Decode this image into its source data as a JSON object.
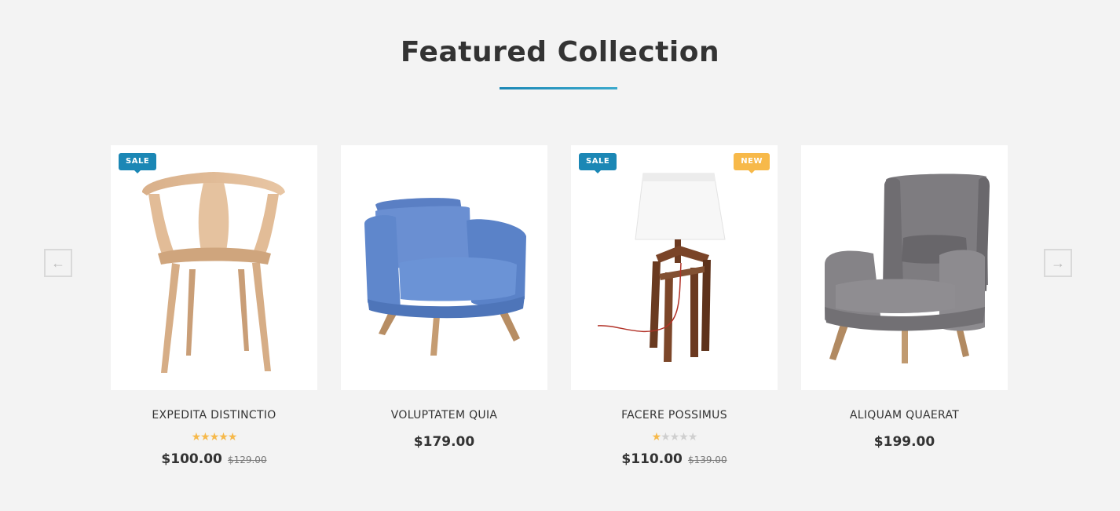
{
  "section": {
    "title": "Featured Collection"
  },
  "navigation": {
    "prev_icon": "←",
    "next_icon": "→"
  },
  "colors": {
    "accent": "#1b87b5",
    "sale_badge": "#1b87b5",
    "new_badge": "#f7b94a",
    "star": "#f6b94b",
    "background": "#f3f3f3"
  },
  "products": [
    {
      "name": "EXPEDITA DISTINCTIO",
      "badge_sale": "SALE",
      "rating": 5,
      "rating_stars": "★★★★★",
      "rating_empty": "",
      "price": "$100.00",
      "old_price": "$129.00",
      "image": "wooden-chair"
    },
    {
      "name": "VOLUPTATEM QUIA",
      "price": "$179.00",
      "image": "blue-armchair"
    },
    {
      "name": "FACERE POSSIMUS",
      "badge_sale": "SALE",
      "badge_new": "NEW",
      "rating": 1,
      "rating_stars": "★",
      "rating_empty": "★★★★",
      "price": "$110.00",
      "old_price": "$139.00",
      "image": "table-lamp"
    },
    {
      "name": "ALIQUAM QUAERAT",
      "price": "$199.00",
      "image": "grey-wingback-chair"
    }
  ]
}
